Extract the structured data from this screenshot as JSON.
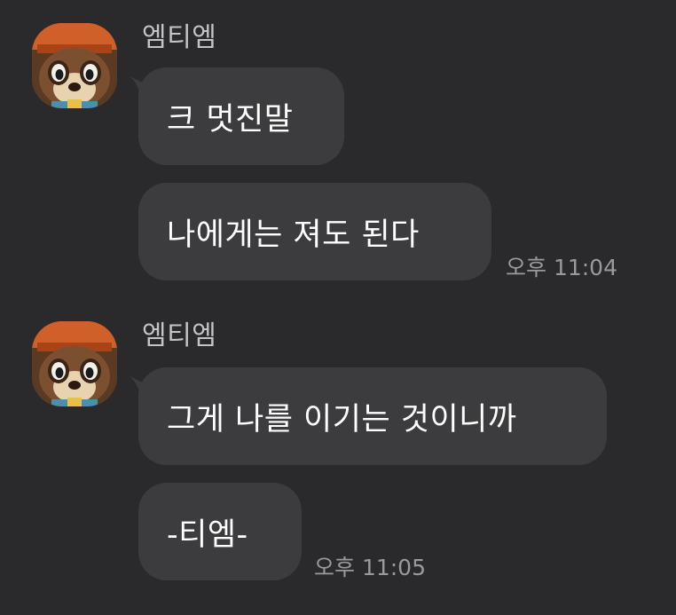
{
  "chat": {
    "groups": [
      {
        "sender": "엠티엠",
        "avatar_icon": "tom-nook-avatar",
        "messages": [
          {
            "text": "크 멋진말"
          },
          {
            "text": "나에게는 져도 된다",
            "time": "오후 11:04"
          }
        ]
      },
      {
        "sender": "엠티엠",
        "avatar_icon": "tom-nook-avatar",
        "messages": [
          {
            "text": "그게 나를 이기는 것이니까"
          },
          {
            "text": "-티엠-",
            "time": "오후 11:05"
          }
        ]
      }
    ]
  },
  "theme": {
    "background": "#2a2a2c",
    "bubble": "#3c3c3e",
    "name_color": "#c4c4c4",
    "time_color": "#9a9a9c"
  }
}
